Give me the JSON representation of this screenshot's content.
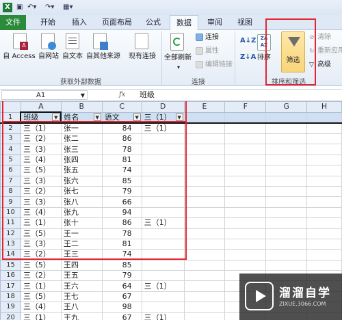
{
  "tabs": [
    "文件",
    "开始",
    "插入",
    "页面布局",
    "公式",
    "数据",
    "审阅",
    "视图"
  ],
  "ribbon": {
    "access": "自 Access",
    "web": "自网站",
    "text": "自文本",
    "other": "自其他来源",
    "existing": "现有连接",
    "refresh_all": "全部刷新",
    "connections": "连接",
    "properties": "属性",
    "edit_links": "编辑链接",
    "sort": "排序",
    "filter": "筛选",
    "clear": "清除",
    "reapply": "重新应用",
    "advanced": "高级",
    "group_external": "获取外部数据",
    "group_connections": "连接",
    "group_sort_filter": "排序和筛选"
  },
  "formula_bar": {
    "name_box": "A1",
    "fx": "fx",
    "content": "班级"
  },
  "columns": [
    "A",
    "B",
    "C",
    "D",
    "E",
    "F",
    "G",
    "H"
  ],
  "header": {
    "row": "1",
    "a": "班级",
    "b": "姓名",
    "c": "语文",
    "d": "三（1）"
  },
  "rows": [
    {
      "n": "2",
      "a": "三（1）",
      "b": "张一",
      "c": "84",
      "d": "三（1）"
    },
    {
      "n": "3",
      "a": "三（2）",
      "b": "张二",
      "c": "86",
      "d": ""
    },
    {
      "n": "4",
      "a": "三（3）",
      "b": "张三",
      "c": "78",
      "d": ""
    },
    {
      "n": "5",
      "a": "三（4）",
      "b": "张四",
      "c": "81",
      "d": ""
    },
    {
      "n": "6",
      "a": "三（5）",
      "b": "张五",
      "c": "74",
      "d": ""
    },
    {
      "n": "7",
      "a": "三（3）",
      "b": "张六",
      "c": "85",
      "d": ""
    },
    {
      "n": "8",
      "a": "三（2）",
      "b": "张七",
      "c": "79",
      "d": ""
    },
    {
      "n": "9",
      "a": "三（3）",
      "b": "张八",
      "c": "66",
      "d": ""
    },
    {
      "n": "10",
      "a": "三（4）",
      "b": "张九",
      "c": "94",
      "d": ""
    },
    {
      "n": "11",
      "a": "三（1）",
      "b": "张十",
      "c": "86",
      "d": "三（1）"
    },
    {
      "n": "12",
      "a": "三（5）",
      "b": "王一",
      "c": "78",
      "d": ""
    },
    {
      "n": "13",
      "a": "三（3）",
      "b": "王二",
      "c": "81",
      "d": ""
    },
    {
      "n": "14",
      "a": "三（2）",
      "b": "王三",
      "c": "74",
      "d": ""
    },
    {
      "n": "15",
      "a": "三（5）",
      "b": "王四",
      "c": "85",
      "d": ""
    },
    {
      "n": "16",
      "a": "三（2）",
      "b": "王五",
      "c": "79",
      "d": ""
    },
    {
      "n": "17",
      "a": "三（1）",
      "b": "王六",
      "c": "64",
      "d": "三（1）"
    },
    {
      "n": "18",
      "a": "三（5）",
      "b": "王七",
      "c": "67",
      "d": ""
    },
    {
      "n": "19",
      "a": "三（4）",
      "b": "王八",
      "c": "98",
      "d": ""
    },
    {
      "n": "20",
      "a": "三（1）",
      "b": "王九",
      "c": "67",
      "d": "三（1）"
    }
  ],
  "watermark": {
    "title": "溜溜自学",
    "url": "ZIXUE.3066.COM"
  },
  "colors": {
    "file_tab": "#2a8b3a",
    "highlight_red": "#e2262e",
    "filter_active": "#f8d57a"
  }
}
